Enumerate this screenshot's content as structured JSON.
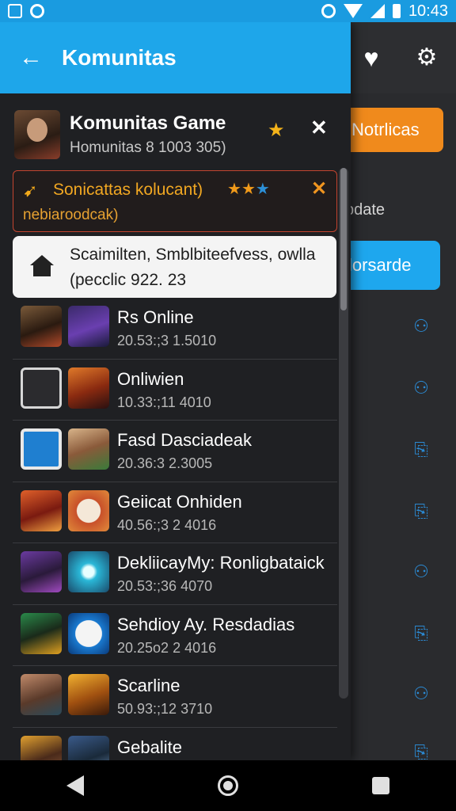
{
  "status_bar": {
    "time": "10:43"
  },
  "drawer": {
    "title": "Komunitas",
    "game": {
      "title": "Komunitas Game",
      "subtitle": "Homunitas 8 1003 305)"
    },
    "alert": {
      "title": "Sonicattas kolucant)",
      "subtitle": "nebiaroodcak)"
    },
    "notice": {
      "line1": "Scaimilten, Smblbiteefvess, owlla",
      "line2": "(pecclic 922. 23"
    },
    "list": [
      {
        "title": "Rs Online",
        "subtitle": "20.53:;3 1.5010"
      },
      {
        "title": "Onliwien",
        "subtitle": "10.33:;11 4010"
      },
      {
        "title": "Fasd Dasciadeak",
        "subtitle": "20.36:3 2.3005"
      },
      {
        "title": "Geiicat Onhiden",
        "subtitle": "40.56:;3 2 4016"
      },
      {
        "title": "DekliicayMy: Ronligbataick",
        "subtitle": "20.53:;36 4070"
      },
      {
        "title": "Sehdioy Ay. Resdadias",
        "subtitle": "20.25o2 2 4016"
      },
      {
        "title": "Scarline",
        "subtitle": "50.93:;12 3710"
      },
      {
        "title": "Gebalite",
        "subtitle": ""
      }
    ]
  },
  "background": {
    "orange_button": "Notrlicas",
    "update_label": "pdate",
    "blue_button": "lorsarde"
  }
}
